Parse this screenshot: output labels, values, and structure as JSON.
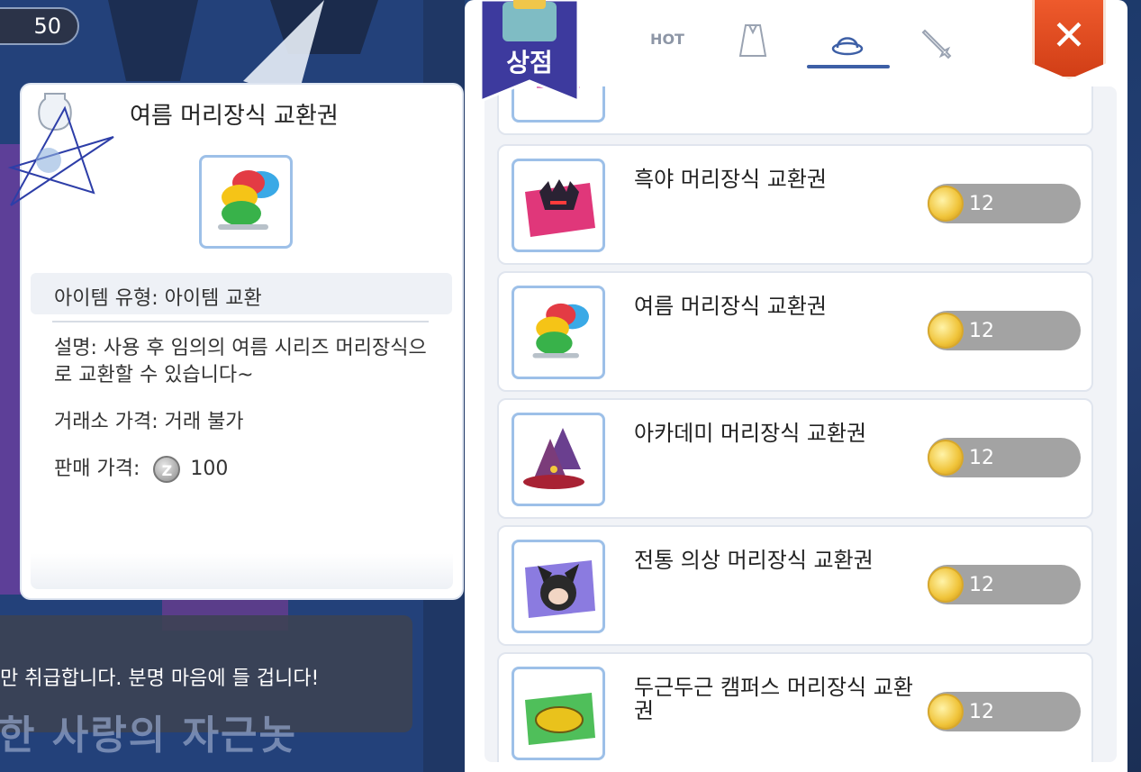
{
  "hud": {
    "level": "50"
  },
  "detail": {
    "title": "여름 머리장식 교환권",
    "type_line": "아이템 유형: 아이템 교환",
    "description": "설명: 사용 후 임의의 여름 시리즈 머리장식으로 교환할 수 있습니다~",
    "trade_price": "거래소 가격: 거래 불가",
    "sell_label": "판매 가격:",
    "sell_coin_icon": "zeny-coin-icon",
    "sell_value": "100"
  },
  "npc": {
    "dialog": "만 취급합니다. 분명 마음에 들 겁니다!",
    "background_text": "한 사랑의 자근놋"
  },
  "shop": {
    "badge_label": "상점",
    "tabs": [
      {
        "label": "HOT",
        "icon": null,
        "active": false
      },
      {
        "label": "",
        "icon": "cape-icon",
        "active": false
      },
      {
        "label": "",
        "icon": "hat-icon",
        "active": true
      },
      {
        "label": "",
        "icon": "sword-icon",
        "active": false
      }
    ],
    "close_label": "✕",
    "items": [
      {
        "name": "흑야 머리장식 교환권",
        "price": "12",
        "icon": "dark-horn-headgear-icon"
      },
      {
        "name": "여름 머리장식 교환권",
        "price": "12",
        "icon": "summer-caps-icon"
      },
      {
        "name": "아카데미 머리장식 교환권",
        "price": "12",
        "icon": "witch-hat-icon"
      },
      {
        "name": "전통 의상 머리장식 교환권",
        "price": "12",
        "icon": "fox-ears-icon"
      },
      {
        "name": "두근두근 캠퍼스 머리장식 교환권",
        "price": "12",
        "icon": "yellow-cap-icon"
      }
    ]
  },
  "colors": {
    "accent_blue": "#3d5fa6",
    "close_red": "#d13e16",
    "frame_blue": "#9dc0e8",
    "price_gray": "#a3a3a3"
  }
}
